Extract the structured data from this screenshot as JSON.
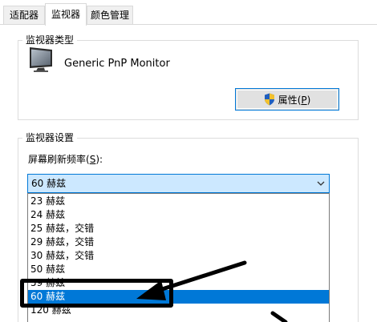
{
  "tabs": [
    {
      "label": "适配器",
      "active": false
    },
    {
      "label": "监视器",
      "active": true
    },
    {
      "label": "颜色管理",
      "active": false
    }
  ],
  "monitor_type": {
    "group_title": "监视器类型",
    "monitor_name": "Generic PnP Monitor",
    "properties_label": "属性",
    "properties_hotkey": "P"
  },
  "monitor_settings": {
    "group_title": "监视器设置",
    "refresh_label": "屏幕刷新频率",
    "refresh_hotkey": "S",
    "selected_value": "60 赫兹",
    "options": [
      {
        "label": "23 赫兹",
        "selected": false
      },
      {
        "label": "24 赫兹",
        "selected": false
      },
      {
        "label": "25 赫兹，交错",
        "selected": false
      },
      {
        "label": "29 赫兹，交错",
        "selected": false
      },
      {
        "label": "30 赫兹，交错",
        "selected": false
      },
      {
        "label": "50 赫兹",
        "selected": false
      },
      {
        "label": "59 赫兹",
        "selected": false
      },
      {
        "label": "60 赫兹",
        "selected": true
      },
      {
        "label": "120 赫兹",
        "selected": false
      }
    ]
  },
  "colors": {
    "accent": "#0078d7",
    "selection_bg": "#cce8ff",
    "annotation": "#000000"
  }
}
